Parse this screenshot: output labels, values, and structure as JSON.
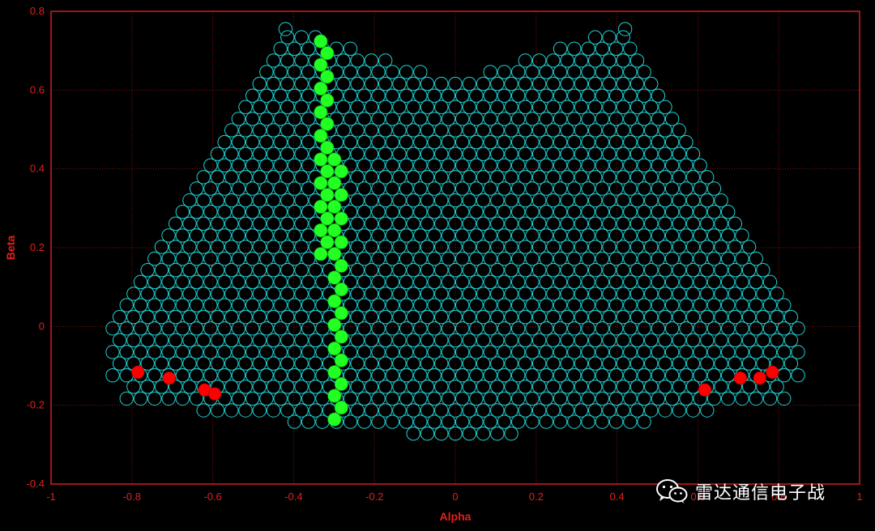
{
  "chart_data": {
    "type": "scatter",
    "xlabel": "Alpha",
    "ylabel": "Beta",
    "xlim": [
      -1,
      1
    ],
    "ylim": [
      -0.4,
      0.8
    ],
    "xticks": [
      "-1",
      "-0.8",
      "-0.6",
      "-0.4",
      "-0.2",
      "0",
      "0.2",
      "0.4",
      "0.6",
      "0.8",
      "1"
    ],
    "yticks": [
      "-0.4",
      "-0.2",
      "0",
      "0.2",
      "0.4",
      "0.6",
      "0.8"
    ],
    "grid": true,
    "lattice": {
      "marker": "open-circle",
      "color": "#1fd1d1",
      "row_spacing": 0.0297,
      "col_spacing": 0.0346,
      "row_half_widths": [
        {
          "y": -0.272,
          "xmin": -0.13,
          "xmax": 0.14
        },
        {
          "y": -0.242,
          "xmin": -0.43,
          "xmax": 0.47
        },
        {
          "y": -0.213,
          "xmin": -0.65,
          "xmax": 0.63
        },
        {
          "y": -0.183,
          "xmin": -0.82,
          "xmax": 0.84
        },
        {
          "y": -0.153,
          "xmin": -0.8,
          "xmax": 0.8
        },
        {
          "y": -0.124,
          "xmin": -0.86,
          "xmax": 0.86
        },
        {
          "y": -0.094,
          "xmin": -0.85,
          "xmax": 0.85
        },
        {
          "y": -0.065,
          "xmin": -0.86,
          "xmax": 0.87
        },
        {
          "y": -0.035,
          "xmin": -0.85,
          "xmax": 0.85
        },
        {
          "y": -0.005,
          "xmin": -0.86,
          "xmax": 0.87
        },
        {
          "y": 0.024,
          "xmin": -0.84,
          "xmax": 0.84
        },
        {
          "y": 0.054,
          "xmin": -0.82,
          "xmax": 0.83
        },
        {
          "y": 0.083,
          "xmin": -0.81,
          "xmax": 0.81
        },
        {
          "y": 0.113,
          "xmin": -0.79,
          "xmax": 0.8
        },
        {
          "y": 0.143,
          "xmin": -0.78,
          "xmax": 0.78
        },
        {
          "y": 0.172,
          "xmin": -0.76,
          "xmax": 0.76
        },
        {
          "y": 0.202,
          "xmin": -0.74,
          "xmax": 0.74
        },
        {
          "y": 0.231,
          "xmin": -0.72,
          "xmax": 0.72
        },
        {
          "y": 0.261,
          "xmin": -0.71,
          "xmax": 0.71
        },
        {
          "y": 0.291,
          "xmin": -0.69,
          "xmax": 0.69
        },
        {
          "y": 0.32,
          "xmin": -0.67,
          "xmax": 0.67
        },
        {
          "y": 0.35,
          "xmin": -0.66,
          "xmax": 0.66
        },
        {
          "y": 0.379,
          "xmin": -0.64,
          "xmax": 0.64
        },
        {
          "y": 0.409,
          "xmin": -0.62,
          "xmax": 0.62
        },
        {
          "y": 0.438,
          "xmin": -0.6,
          "xmax": 0.6
        },
        {
          "y": 0.468,
          "xmin": -0.59,
          "xmax": 0.59
        },
        {
          "y": 0.498,
          "xmin": -0.57,
          "xmax": 0.57
        },
        {
          "y": 0.527,
          "xmin": -0.55,
          "xmax": 0.55
        },
        {
          "y": 0.557,
          "xmin": -0.53,
          "xmax": 0.54
        },
        {
          "y": 0.586,
          "xmin": -0.52,
          "xmax": 0.52
        },
        {
          "y": 0.616,
          "xmin": -0.5,
          "xmax": 0.5
        },
        {
          "y": 0.646,
          "xmin": -0.49,
          "xmax": 0.49
        },
        {
          "y": 0.675,
          "xmin": -0.47,
          "xmax": 0.47
        },
        {
          "y": 0.705,
          "xmin": -0.45,
          "xmax": 0.45
        },
        {
          "y": 0.734,
          "xmin": -0.44,
          "xmax": 0.44
        }
      ],
      "notch": {
        "y_from": 0.62,
        "x_center": 0.0,
        "half_width_at_top": 0.35,
        "exclude_center_column_below": 0.69
      },
      "extra_points": [
        [
          -0.42,
          0.755
        ],
        [
          0.42,
          0.755
        ]
      ]
    },
    "green_points": {
      "color": "#22ff22",
      "points": [
        [
          -0.333,
          0.724
        ],
        [
          -0.317,
          0.694
        ],
        [
          -0.333,
          0.664
        ],
        [
          -0.317,
          0.634
        ],
        [
          -0.333,
          0.604
        ],
        [
          -0.317,
          0.574
        ],
        [
          -0.333,
          0.544
        ],
        [
          -0.317,
          0.514
        ],
        [
          -0.333,
          0.484
        ],
        [
          -0.317,
          0.454
        ],
        [
          -0.333,
          0.424
        ],
        [
          -0.299,
          0.424
        ],
        [
          -0.317,
          0.394
        ],
        [
          -0.282,
          0.394
        ],
        [
          -0.333,
          0.364
        ],
        [
          -0.299,
          0.364
        ],
        [
          -0.317,
          0.334
        ],
        [
          -0.282,
          0.334
        ],
        [
          -0.333,
          0.304
        ],
        [
          -0.299,
          0.304
        ],
        [
          -0.317,
          0.274
        ],
        [
          -0.282,
          0.274
        ],
        [
          -0.333,
          0.244
        ],
        [
          -0.299,
          0.244
        ],
        [
          -0.317,
          0.214
        ],
        [
          -0.282,
          0.214
        ],
        [
          -0.333,
          0.184
        ],
        [
          -0.299,
          0.184
        ],
        [
          -0.282,
          0.154
        ],
        [
          -0.299,
          0.124
        ],
        [
          -0.282,
          0.094
        ],
        [
          -0.299,
          0.064
        ],
        [
          -0.282,
          0.034
        ],
        [
          -0.299,
          0.004
        ],
        [
          -0.282,
          -0.026
        ],
        [
          -0.299,
          -0.056
        ],
        [
          -0.282,
          -0.086
        ],
        [
          -0.299,
          -0.116
        ],
        [
          -0.282,
          -0.146
        ],
        [
          -0.299,
          -0.176
        ],
        [
          -0.282,
          -0.206
        ],
        [
          -0.299,
          -0.236
        ]
      ]
    },
    "red_points": {
      "color": "#ff0000",
      "points": [
        [
          -0.785,
          -0.116
        ],
        [
          -0.708,
          -0.131
        ],
        [
          -0.62,
          -0.161
        ],
        [
          -0.595,
          -0.171
        ],
        [
          0.617,
          -0.161
        ],
        [
          0.705,
          -0.131
        ],
        [
          0.753,
          -0.131
        ],
        [
          0.784,
          -0.116
        ]
      ]
    }
  },
  "watermark": {
    "icon": "wechat-icon",
    "text": "雷达通信电子战"
  }
}
